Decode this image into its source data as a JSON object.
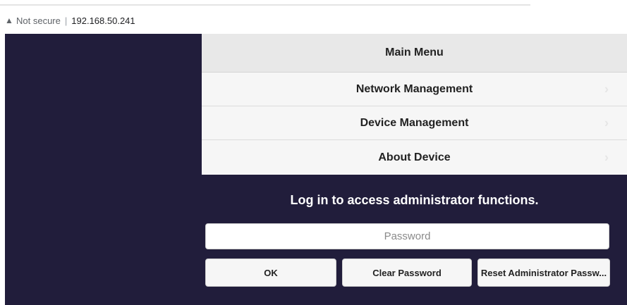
{
  "browser": {
    "security_label": "Not secure",
    "separator": "|",
    "url": "192.168.50.241"
  },
  "menu": {
    "title": "Main Menu",
    "items": [
      {
        "label": "Network Management"
      },
      {
        "label": "Device Management"
      },
      {
        "label": "About Device"
      }
    ]
  },
  "login": {
    "prompt": "Log in to access administrator functions.",
    "password_placeholder": "Password",
    "ok_label": "OK",
    "clear_label": "Clear Password",
    "reset_label": "Reset Administrator Passw..."
  },
  "colors": {
    "background": "#211d3b",
    "menu_background": "#f6f6f6",
    "menu_header_background": "#e8e8e8"
  },
  "icons": {
    "security": "warning-triangle-icon",
    "menu_item": "chevron-right-icon"
  }
}
